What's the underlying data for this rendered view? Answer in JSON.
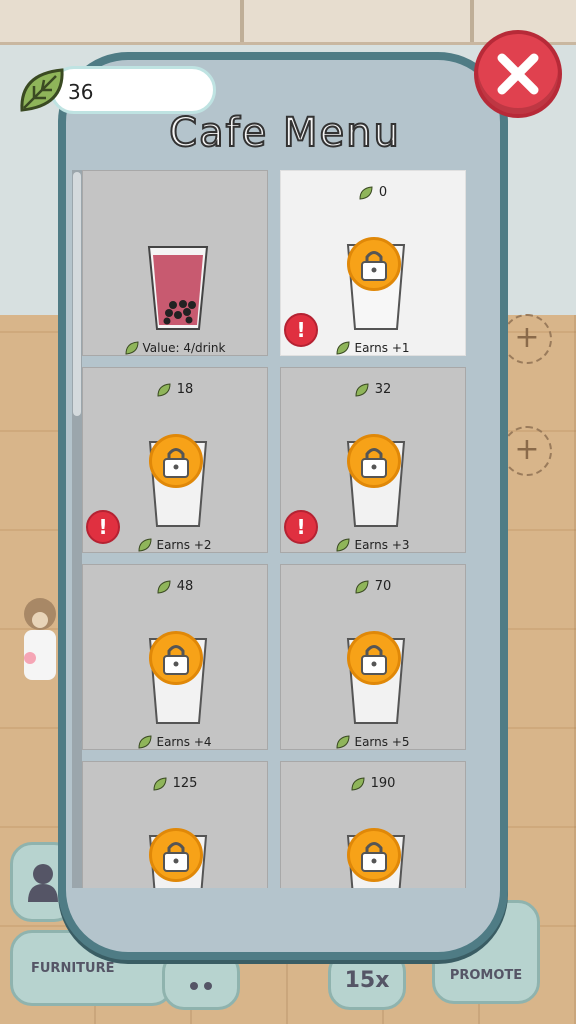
{
  "leaf_count": "36",
  "title": "Cafe Menu",
  "background_buttons": {
    "furniture": "FURNITURE",
    "multiplier": "15x",
    "promote": "PROMOTE"
  },
  "colors": {
    "panel_border": "#4f7c85",
    "panel_bg": "#b4c4cc",
    "close_red": "#e0414f",
    "lock_orange": "#f7a218",
    "alert_red": "#e03040"
  },
  "items": [
    {
      "cost": "",
      "label": "Value: 4/drink",
      "unlocked": true,
      "alert": false
    },
    {
      "cost": "0",
      "label": "Earns +1",
      "unlocked": false,
      "alert": true,
      "selected": true
    },
    {
      "cost": "18",
      "label": "Earns +2",
      "unlocked": false,
      "alert": true
    },
    {
      "cost": "32",
      "label": "Earns +3",
      "unlocked": false,
      "alert": true
    },
    {
      "cost": "48",
      "label": "Earns +4",
      "unlocked": false,
      "alert": false
    },
    {
      "cost": "70",
      "label": "Earns +5",
      "unlocked": false,
      "alert": false
    },
    {
      "cost": "125",
      "label": "",
      "unlocked": false,
      "alert": false
    },
    {
      "cost": "190",
      "label": "",
      "unlocked": false,
      "alert": false
    }
  ],
  "icons": {
    "leaf": "leaf-icon",
    "close": "close-icon",
    "lock": "lock-icon",
    "alert": "exclamation-icon",
    "cup": "cup-icon"
  }
}
